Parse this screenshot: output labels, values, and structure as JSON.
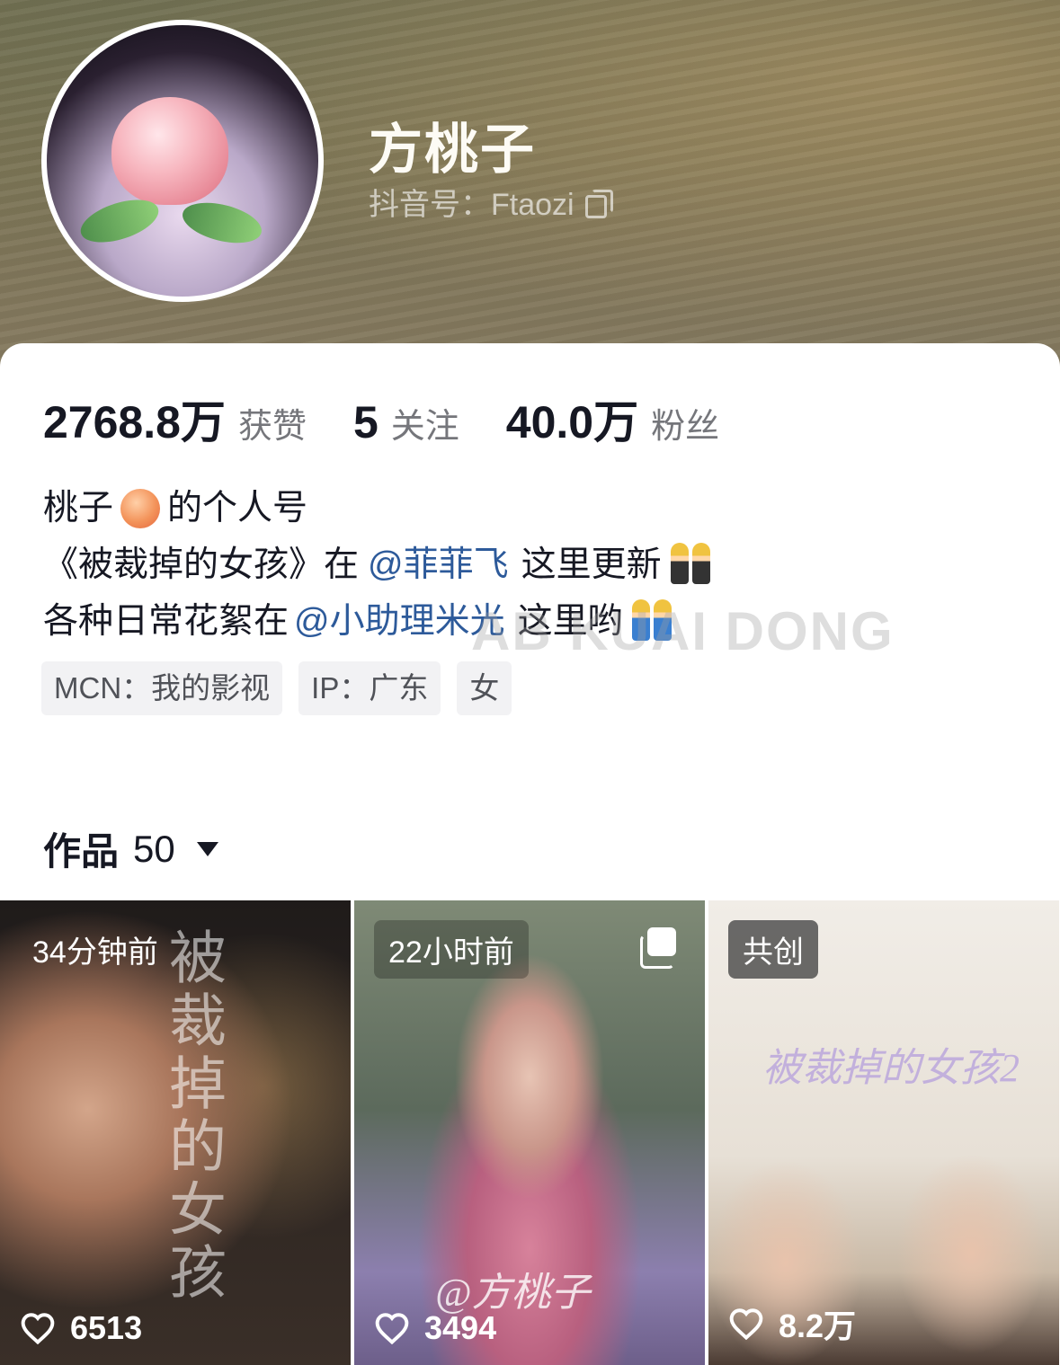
{
  "profile": {
    "name": "方桃子",
    "douyin_id": "抖音号：Ftaozi"
  },
  "stats": [
    {
      "value": "2768.8万",
      "label": "获赞"
    },
    {
      "value": "5",
      "label": "关注"
    },
    {
      "value": "40.0万",
      "label": "粉丝"
    }
  ],
  "bio": {
    "line1_a": "桃子",
    "line1_b": "的个人号",
    "line2_a": "《被裁掉的女孩》在",
    "line2_mention": "@菲菲飞",
    "line2_b": "这里更新",
    "line3_a": "各种日常花絮在",
    "line3_mention": "@小助理米光",
    "line3_b": "这里哟"
  },
  "tags": [
    "MCN：我的影视",
    "IP：广东",
    "女"
  ],
  "watermark": "AB KUAI DONG",
  "works": {
    "label": "作品",
    "count": "50"
  },
  "tiles": [
    {
      "badge": "34分钟前",
      "likes": "6513",
      "overlay": "被裁掉的女孩"
    },
    {
      "badge": "22小时前",
      "likes": "3494",
      "overlay": "@方桃子"
    },
    {
      "badge": "共创",
      "likes": "8.2万",
      "overlay": "被裁掉的女孩2"
    }
  ],
  "icons": {
    "copy": "copy-icon",
    "heart": "heart-icon",
    "caret": "chevron-down-icon",
    "multi_image": "multi-image-icon"
  },
  "colors": {
    "mention": "#2d5a9a",
    "tag_bg": "#f2f2f4",
    "text_primary": "#161823",
    "text_secondary": "#75767b"
  }
}
